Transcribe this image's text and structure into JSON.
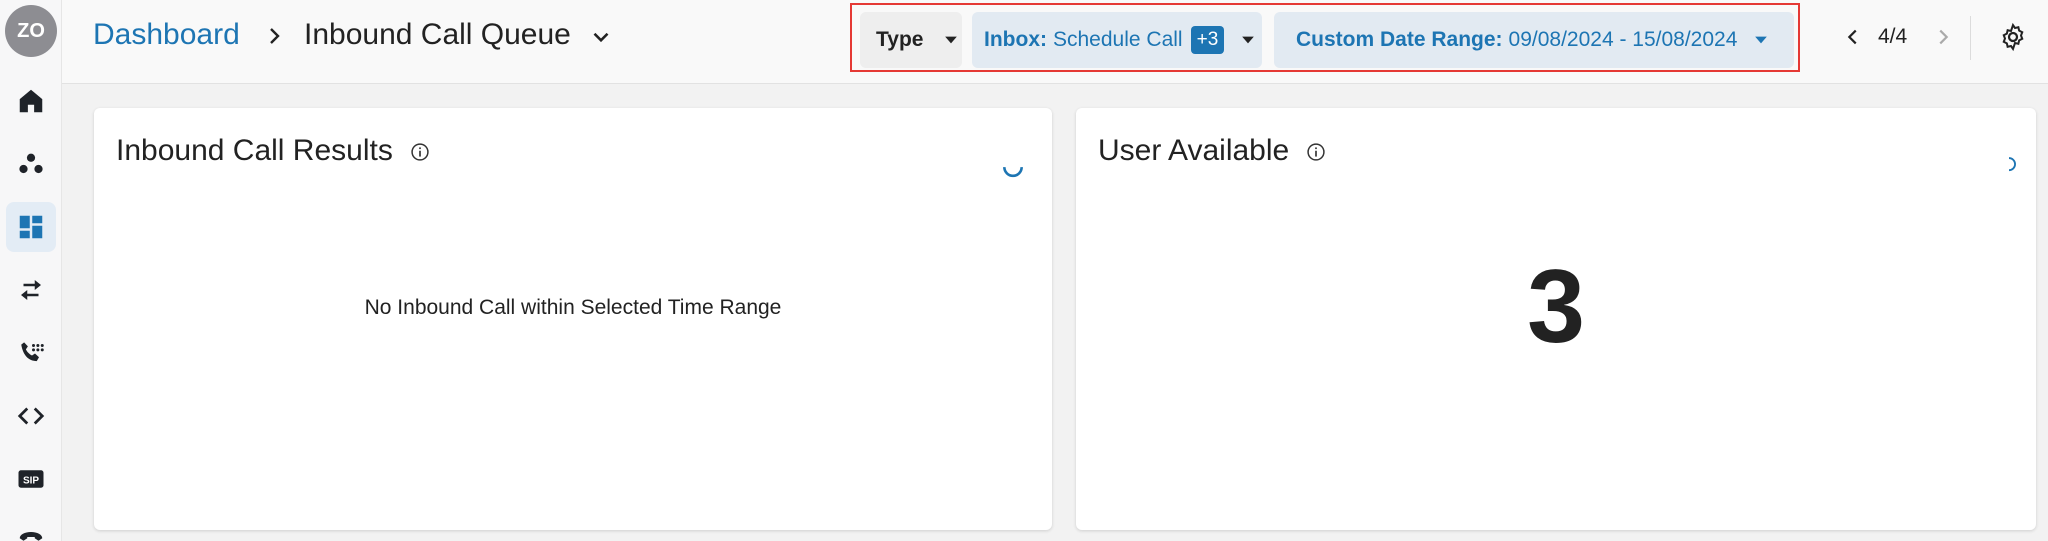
{
  "sidebar": {
    "avatar_initials": "ZO",
    "items": [
      {
        "icon": "home-icon"
      },
      {
        "icon": "team-icon"
      },
      {
        "icon": "dashboard-icon",
        "active": true
      },
      {
        "icon": "transfer-arrows-icon"
      },
      {
        "icon": "phone-keypad-icon"
      },
      {
        "icon": "code-icon"
      },
      {
        "icon": "sip-icon",
        "label": "SIP"
      },
      {
        "icon": "telephone-icon"
      }
    ]
  },
  "header": {
    "breadcrumb_root": "Dashboard",
    "breadcrumb_current": "Inbound Call Queue"
  },
  "filters": {
    "type_label": "Type",
    "inbox_key": "Inbox:",
    "inbox_value": "Schedule Call",
    "inbox_extra_badge": "+3",
    "date_key": "Custom Date Range:",
    "date_value": "09/08/2024 - 15/08/2024"
  },
  "pager": {
    "text": "4/4"
  },
  "cards": {
    "inbound_results": {
      "title": "Inbound Call Results",
      "empty_message": "No Inbound Call within Selected Time Range"
    },
    "user_available": {
      "title": "User Available",
      "value": "3"
    }
  },
  "colors": {
    "accent": "#1d75b3",
    "highlight_border": "#e53935",
    "pill_bg": "#e2eaf2"
  }
}
